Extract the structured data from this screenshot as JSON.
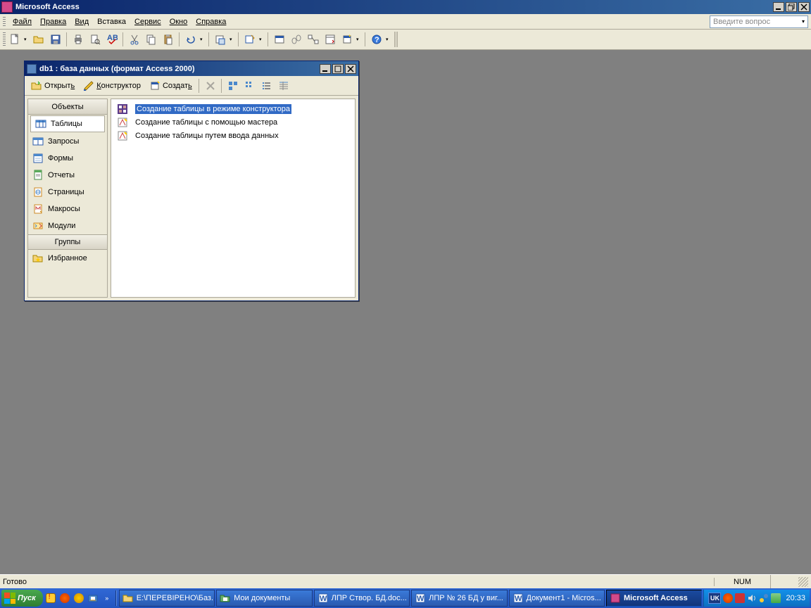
{
  "app": {
    "title": "Microsoft Access"
  },
  "menu": {
    "file": "Файл",
    "edit": "Правка",
    "view": "Вид",
    "insert": "Вставка",
    "tools": "Сервис",
    "window": "Окно",
    "help": "Справка"
  },
  "questionBox": {
    "placeholder": "Введите вопрос"
  },
  "dbwin": {
    "title": "db1 : база данных (формат Access 2000)",
    "toolbar": {
      "open": "Открыть",
      "design": "Конструктор",
      "create": "Создать"
    },
    "objHeader": "Объекты",
    "obj": {
      "tables": "Таблицы",
      "queries": "Запросы",
      "forms": "Формы",
      "reports": "Отчеты",
      "pages": "Страницы",
      "macros": "Макросы",
      "modules": "Модули"
    },
    "grpHeader": "Группы",
    "grp": {
      "favorites": "Избранное"
    },
    "list": {
      "item0": "Создание таблицы в режиме конструктора",
      "item1": "Создание таблицы с помощью мастера",
      "item2": "Создание таблицы путем ввода данных"
    }
  },
  "status": {
    "ready": "Готово",
    "num": "NUM"
  },
  "taskbar": {
    "start": "Пуск",
    "task0": "E:\\ПЕРЕВІРЕНО\\Баз...",
    "task1": "Мои документы",
    "task2": "ЛПР Створ. БД.doc...",
    "task3": "ЛПР № 26 БД у виг...",
    "task4": "Документ1 - Micros...",
    "task5": "Microsoft Access",
    "lang": "UK",
    "clock": "20:33"
  }
}
